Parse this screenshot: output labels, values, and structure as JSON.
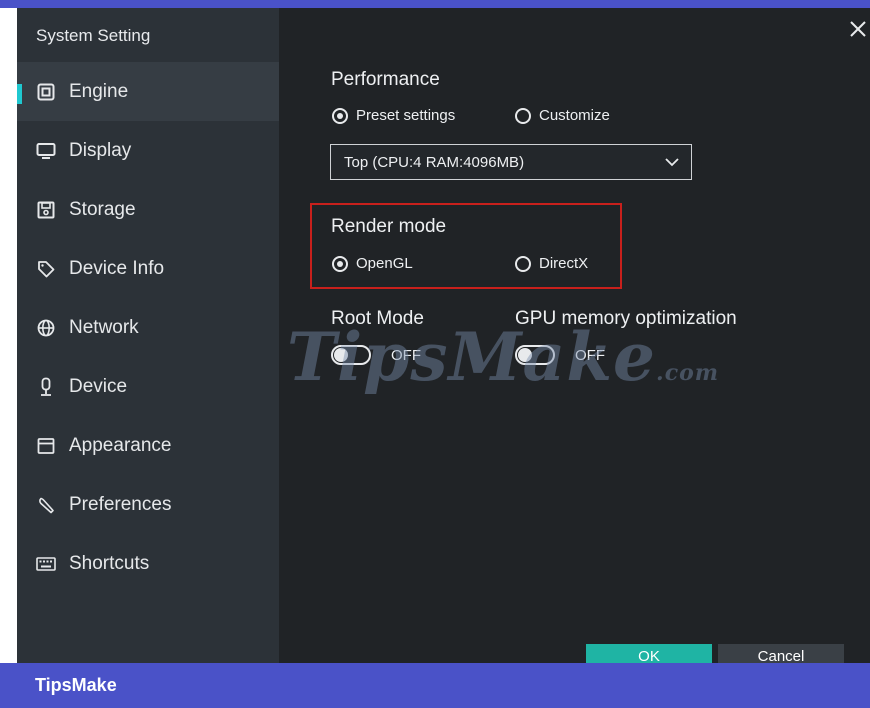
{
  "window": {
    "title": "System Setting",
    "close_icon": "close-icon"
  },
  "sidebar": {
    "items": [
      {
        "label": "Engine",
        "icon": "chip-icon",
        "active": true
      },
      {
        "label": "Display",
        "icon": "monitor-icon",
        "active": false
      },
      {
        "label": "Storage",
        "icon": "save-icon",
        "active": false
      },
      {
        "label": "Device Info",
        "icon": "tag-icon",
        "active": false
      },
      {
        "label": "Network",
        "icon": "globe-icon",
        "active": false
      },
      {
        "label": "Device",
        "icon": "microphone-icon",
        "active": false
      },
      {
        "label": "Appearance",
        "icon": "window-icon",
        "active": false
      },
      {
        "label": "Preferences",
        "icon": "wrench-icon",
        "active": false
      },
      {
        "label": "Shortcuts",
        "icon": "keyboard-icon",
        "active": false
      }
    ]
  },
  "performance": {
    "title": "Performance",
    "options": [
      {
        "label": "Preset settings",
        "checked": true
      },
      {
        "label": "Customize",
        "checked": false
      }
    ],
    "selected_value": "Top (CPU:4 RAM:4096MB)"
  },
  "render_mode": {
    "title": "Render mode",
    "options": [
      {
        "label": "OpenGL",
        "checked": true
      },
      {
        "label": "DirectX",
        "checked": false
      }
    ]
  },
  "root_mode": {
    "title": "Root Mode",
    "state": "OFF"
  },
  "gpu_memory": {
    "title": "GPU memory optimization",
    "state": "OFF"
  },
  "buttons": {
    "ok_label": "OK",
    "cancel_label": "Cancel"
  },
  "watermark": {
    "text": "TipsMake",
    "suffix": ".com"
  },
  "footer": {
    "brand": "TipsMake"
  },
  "colors": {
    "accent": "#1fc8d0",
    "ok_button": "#1fb4a4",
    "highlight_box": "#c8201c",
    "frame_blue": "#4a52c8"
  }
}
